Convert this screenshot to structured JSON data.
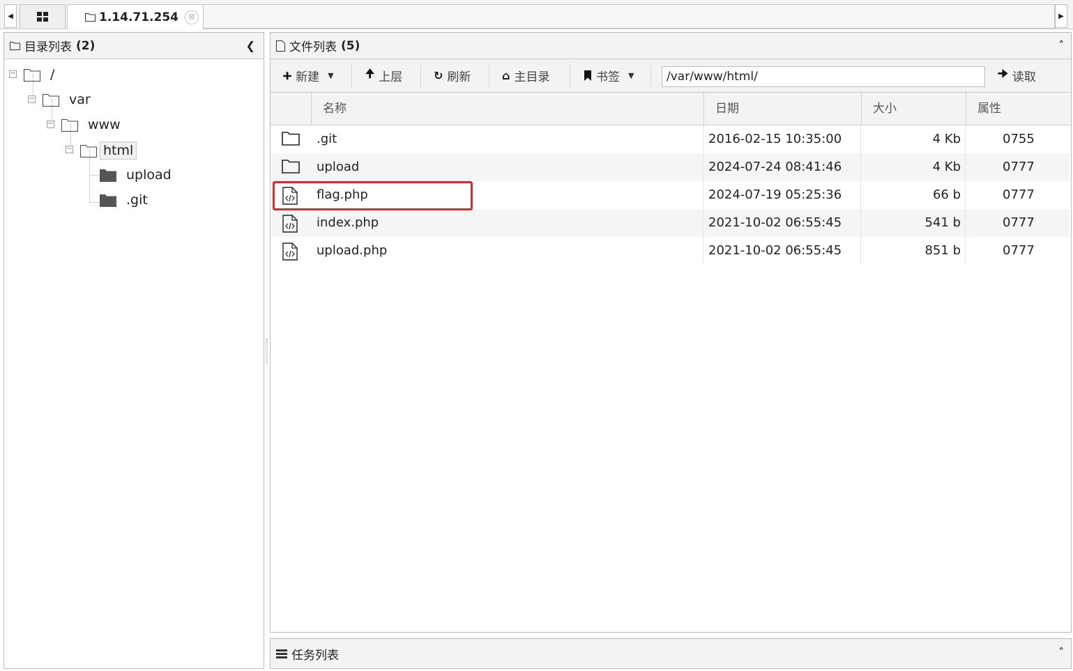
{
  "tab": {
    "title": "1.14.71.254",
    "close_symbol": "⊗"
  },
  "dir_panel": {
    "title": "目录列表",
    "count": "(2)"
  },
  "tree": [
    {
      "label": "/"
    },
    {
      "label": "var"
    },
    {
      "label": "www"
    },
    {
      "label": "html",
      "selected": true
    },
    {
      "label": "upload"
    },
    {
      "label": ".git"
    }
  ],
  "file_panel": {
    "title": "文件列表",
    "count": "(5)"
  },
  "toolbar": {
    "new_label": "新建",
    "up_label": "上层",
    "refresh_label": "刷新",
    "home_label": "主目录",
    "bookmark_label": "书签",
    "path_value": "/var/www/html/",
    "read_label": "读取"
  },
  "columns": {
    "name": "名称",
    "date": "日期",
    "size": "大小",
    "attr": "属性"
  },
  "files": [
    {
      "type": "folder",
      "name": ".git",
      "date": "2016-02-15 10:35:00",
      "size": "4 Kb",
      "perm": "0755"
    },
    {
      "type": "folder",
      "name": "upload",
      "date": "2024-07-24 08:41:46",
      "size": "4 Kb",
      "perm": "0777"
    },
    {
      "type": "code",
      "name": "flag.php",
      "date": "2024-07-19 05:25:36",
      "size": "66 b",
      "perm": "0777"
    },
    {
      "type": "code",
      "name": "index.php",
      "date": "2021-10-02 06:55:45",
      "size": "541 b",
      "perm": "0777"
    },
    {
      "type": "code",
      "name": "upload.php",
      "date": "2021-10-02 06:55:45",
      "size": "851 b",
      "perm": "0777"
    }
  ],
  "highlight_color": "#e4252a",
  "task_panel": {
    "title": "任务列表"
  }
}
